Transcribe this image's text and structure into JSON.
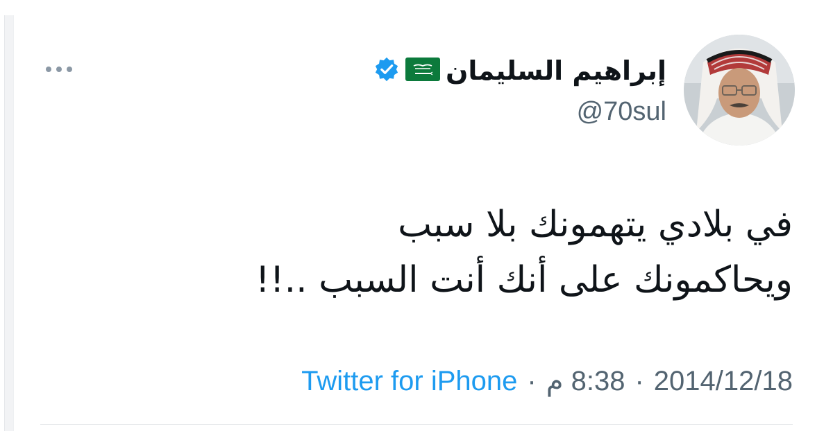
{
  "tweet": {
    "author": {
      "display_name": "إبراهيم السليمان",
      "handle": "@70sul",
      "flag_icon": "saudi-flag",
      "verified_icon": "verified-badge",
      "verified_color": "#1d9bf0"
    },
    "text_lines": [
      "في بلادي يتهمونك بلا سبب",
      "ويحاكمونك على أنك أنت السبب ..!!"
    ],
    "meta": {
      "date": "2014/12/18",
      "time": "8:38 م",
      "separator": "·",
      "source": "Twitter for iPhone",
      "source_color": "#1d9bf0"
    },
    "more_icon": "ellipsis-icon"
  }
}
